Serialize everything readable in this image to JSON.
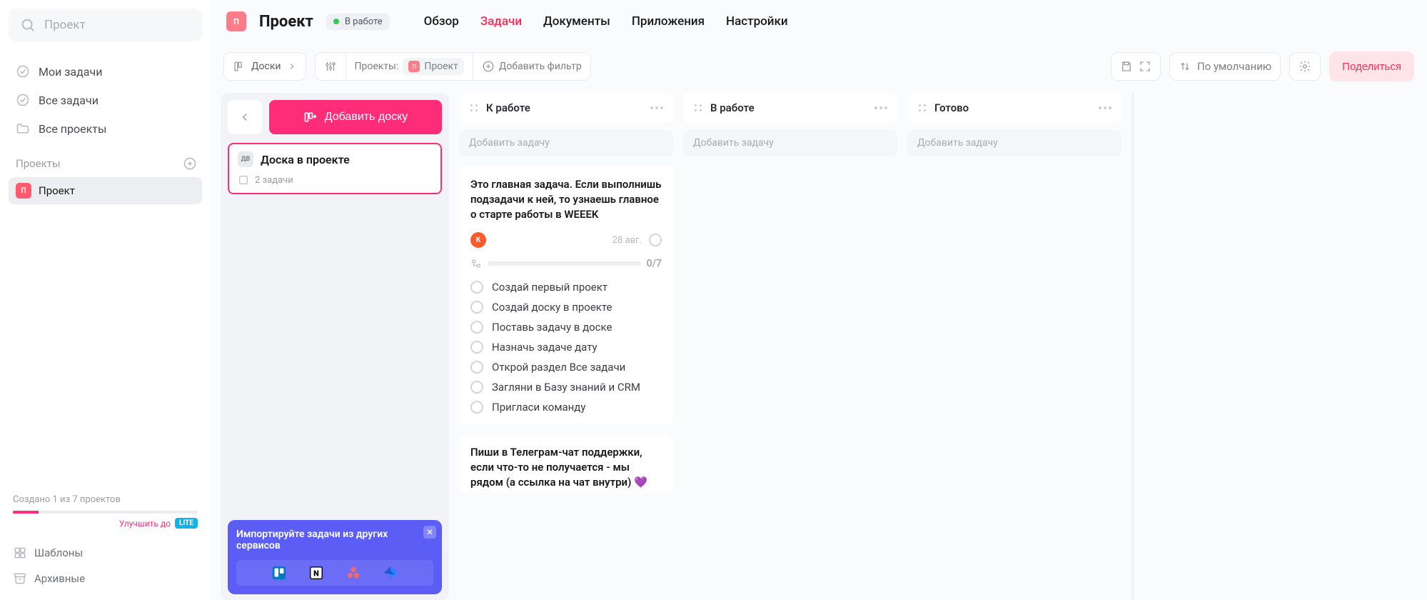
{
  "sidebar": {
    "search_placeholder": "Проект",
    "nav": {
      "my_tasks": "Мои задачи",
      "all_tasks": "Все задачи",
      "all_projects": "Все проекты"
    },
    "projects_header": "Проекты",
    "project_badge": "П",
    "project_name": "Проект",
    "usage_text": "Создано 1 из 7 проектов",
    "upgrade_text": "Улучшить до",
    "upgrade_badge": "LITE",
    "templates": "Шаблоны",
    "archived": "Архивные"
  },
  "header": {
    "badge": "П",
    "title": "Проект",
    "status": "В работе",
    "nav": {
      "overview": "Обзор",
      "tasks": "Задачи",
      "documents": "Документы",
      "apps": "Приложения",
      "settings": "Настройки"
    }
  },
  "toolbar": {
    "boards": "Доски",
    "projects_label": "Проекты:",
    "project_chip_badge": "П",
    "project_chip_name": "Проект",
    "add_filter": "Добавить фильтр",
    "sort": "По умолчанию",
    "share": "Поделиться"
  },
  "board_panel": {
    "add_board": "Добавить доску",
    "board_badge": "ДВ",
    "board_name": "Доска в проекте",
    "task_count": "2 задачи",
    "import_title": "Импортируйте задачи из других сервисов"
  },
  "columns": {
    "todo": {
      "title": "К работе",
      "add_task": "Добавить задачу"
    },
    "in_progress": {
      "title": "В работе",
      "add_task": "Добавить задачу"
    },
    "done": {
      "title": "Готово",
      "add_task": "Добавить задачу"
    }
  },
  "task1": {
    "title": "Это главная задача. Если выполнишь подзадачи к ней, то узнаешь главное о старте работы в WEEEK",
    "avatar": "К",
    "date": "28 авг.",
    "progress": "0/7",
    "subtasks": [
      "Создай первый проект",
      "Создай доску в проекте",
      "Поставь задачу в доске",
      "Назначь задаче дату",
      "Открой раздел Все задачи",
      "Загляни в Базу знаний и CRM",
      "Пригласи команду"
    ]
  },
  "task2": {
    "title": "Пиши в Телеграм-чат поддержки, если что-то не получается - мы рядом (а ссылка на чат внутри) 💜"
  }
}
